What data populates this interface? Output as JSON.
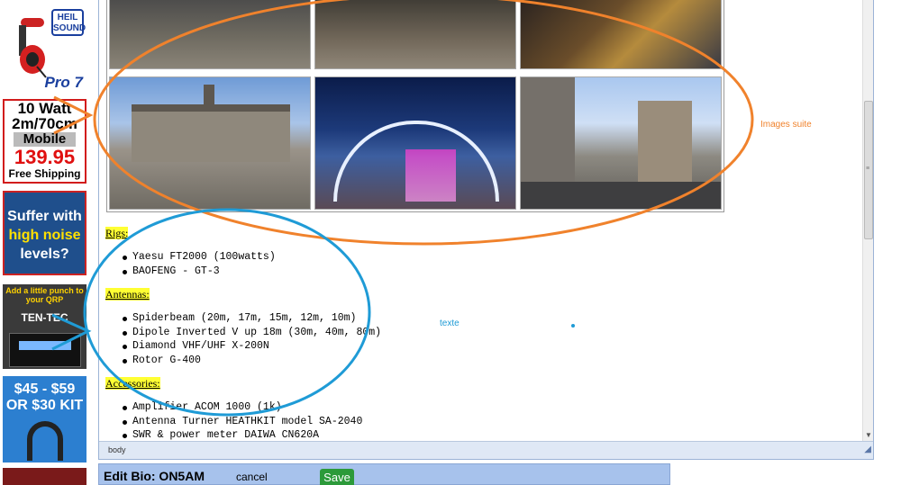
{
  "ads": {
    "heil": {
      "brand": "HEIL SOUND",
      "model": "Pro 7"
    },
    "mobile": {
      "line1": "10 Watt",
      "line2": "2m/70cm",
      "line3": "Mobile",
      "price": "139.95",
      "shipping": "Free Shipping"
    },
    "noise": {
      "line1": "Suffer with",
      "line2": "high noise",
      "line3": "levels?"
    },
    "tentec": {
      "tagline": "Add a little punch to your QRP",
      "brand": "TEN-TEC"
    },
    "kit": {
      "line1": "$45 - $59",
      "line2": "OR $30 KIT"
    }
  },
  "editor": {
    "sections": [
      {
        "heading": "Rigs:",
        "items": [
          "Yaesu FT2000 (100watts)",
          "BAOFENG - GT-3"
        ]
      },
      {
        "heading": "Antennas:",
        "items": [
          "Spiderbeam (20m, 17m, 15m, 12m, 10m)",
          "Dipole Inverted V up 18m (30m, 40m, 80m)",
          "Diamond VHF/UHF X-200N",
          "Rotor G-400"
        ]
      },
      {
        "heading": "Accessories:",
        "items": [
          "Amplifier ACOM 1000 (1k)",
          "Antenna Turner HEATHKIT model SA-2040",
          "SWR & power meter DAIWA CN620A"
        ]
      }
    ],
    "status_path": "body"
  },
  "annotations": {
    "images_label": "Images suite",
    "text_label": "texte",
    "colors": {
      "orange": "#f0822c",
      "blue": "#1f9bd6"
    }
  },
  "bio_bar": {
    "title": "Edit Bio: ON5AM",
    "cancel_label": "cancel",
    "save_label": "Save"
  }
}
